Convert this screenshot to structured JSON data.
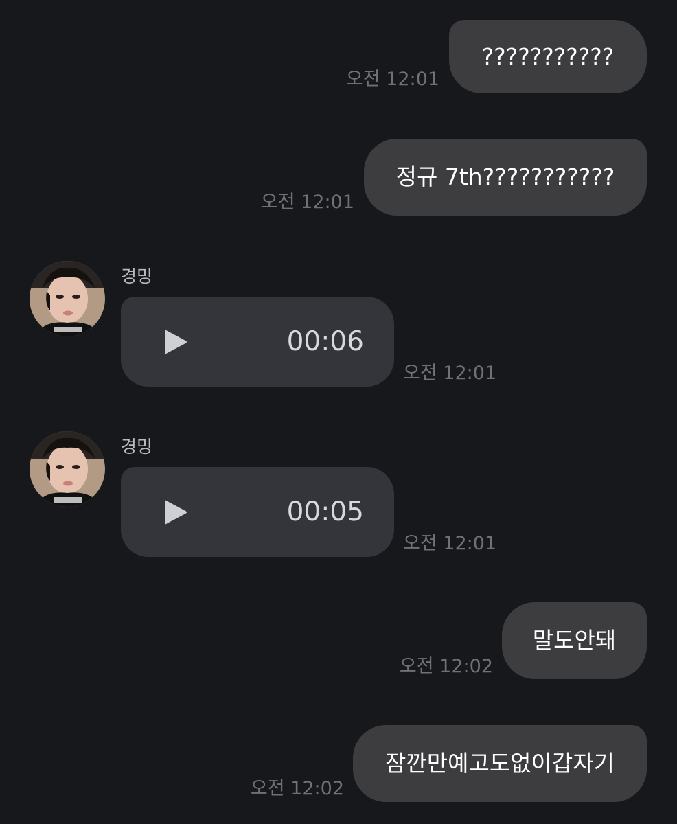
{
  "messages": [
    {
      "type": "outgoing",
      "text": "???????????",
      "time": "오전 12:01"
    },
    {
      "type": "outgoing",
      "text": "정규 7th???????????",
      "time": "오전 12:01"
    },
    {
      "type": "incoming-voice",
      "sender": "경밍",
      "avatar_icon": "profile-photo",
      "duration": "00:06",
      "time": "오전 12:01"
    },
    {
      "type": "incoming-voice",
      "sender": "경밍",
      "avatar_icon": "profile-photo",
      "duration": "00:05",
      "time": "오전 12:01"
    },
    {
      "type": "outgoing",
      "text": "말도안돼",
      "time": "오전 12:02"
    },
    {
      "type": "outgoing",
      "text": "잠깐만예고도없이갑자기",
      "time": "오전 12:02"
    }
  ],
  "colors": {
    "background": "#17181c",
    "outgoing_bubble": "#3d3d3f",
    "voice_bubble": "#33353b",
    "timestamp": "#6f7177"
  }
}
